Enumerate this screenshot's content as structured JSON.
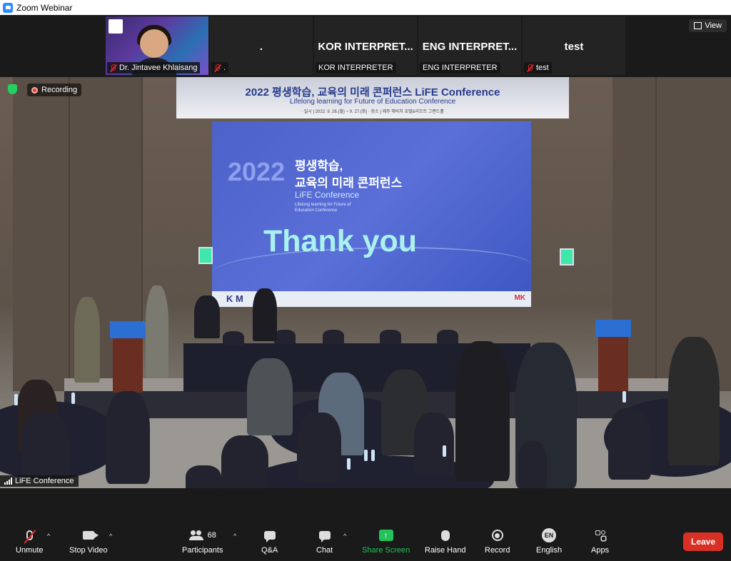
{
  "window": {
    "title": "Zoom Webinar"
  },
  "top_strip": {
    "tiles": [
      {
        "name": "Dr. Jintavee Khlaisang",
        "display": "",
        "muted": true
      },
      {
        "name": ".",
        "display": ".",
        "muted": true
      },
      {
        "name": "KOR INTERPRETER",
        "display": "KOR  INTERPRET...",
        "muted": false
      },
      {
        "name": "ENG INTERPRETER",
        "display": "ENG  INTERPRET...",
        "muted": false
      },
      {
        "name": "test",
        "display": "test",
        "muted": true
      }
    ],
    "view_label": "View"
  },
  "meeting": {
    "recording_label": "Recording",
    "active_speaker": "LiFE Conference"
  },
  "stage_content": {
    "banner_title": "2022 평생학습, 교육의 미래 콘퍼런스 LiFE Conference",
    "banner_subtitle": "Lifelong learning for Future of Education Conference",
    "banner_meta": "· 일시 | 2022. 9. 26.(월) ~ 9. 27.(화)     · 장소 | 제주 해비치 호텔&리조트 그랜드홀",
    "screen_year": "2022",
    "screen_title_line1": "평생학습,",
    "screen_title_line2": "교육의 미래 콘퍼런스",
    "screen_conf": "LiFE Conference",
    "screen_tiny": "Lifelong learning for Future of Education Conference",
    "screen_thanks": "Thank you",
    "screen_footer_left": "K M",
    "screen_footer_right": "MK"
  },
  "toolbar": {
    "unmute": "Unmute",
    "stop_video": "Stop Video",
    "participants": "Participants",
    "participants_count": "68",
    "qa": "Q&A",
    "chat": "Chat",
    "share_screen": "Share Screen",
    "raise_hand": "Raise Hand",
    "record": "Record",
    "language_code": "EN",
    "language": "English",
    "apps": "Apps",
    "leave": "Leave"
  },
  "colors": {
    "share_green": "#23c25a",
    "leave_red": "#d93025",
    "muted_red": "#e02828",
    "screen_blue": "#4c62c9"
  }
}
